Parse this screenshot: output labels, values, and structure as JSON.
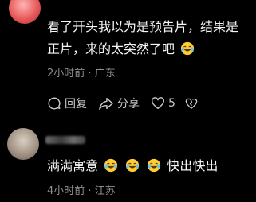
{
  "comments": [
    {
      "avatar_icon": "avatar-cartoon",
      "text_line1": "看了开头我以为是预告片，结果是",
      "text_line2": "正片，来的太突然了吧",
      "emoji": "laugh-cry-emoji",
      "time": "2小时前",
      "separator": "·",
      "location": "广东",
      "actions": {
        "reply": "回复",
        "share": "分享",
        "like_count": "5"
      }
    },
    {
      "avatar_icon": "avatar-photo",
      "text_prefix": "满满寓意",
      "text_suffix": "快出快出",
      "emojis": [
        "laugh-cry-emoji",
        "laugh-cry-emoji",
        "laugh-cry-emoji"
      ],
      "time": "4小时前",
      "separator": "·",
      "location": "江苏"
    }
  ],
  "colors": {
    "background": "#000000",
    "text": "#f5f5f5",
    "meta": "#8e8e93",
    "action": "#c8c8cc",
    "emoji_face": "#ffcc33"
  }
}
